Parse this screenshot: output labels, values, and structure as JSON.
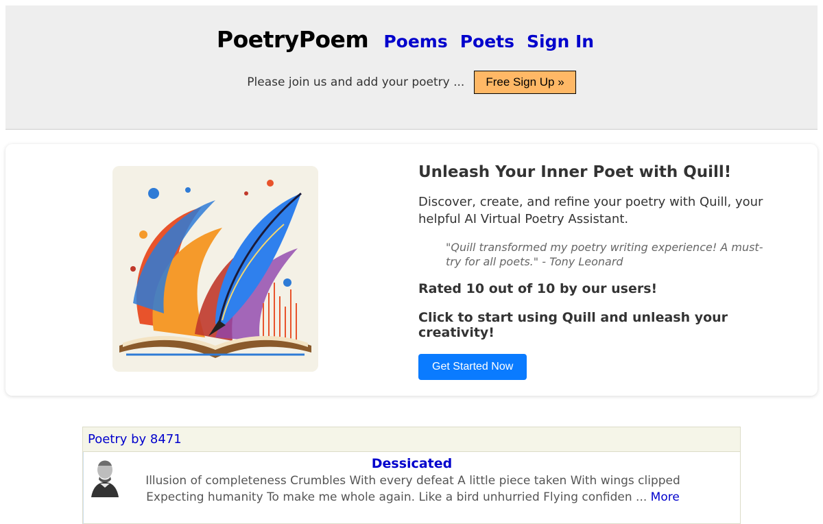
{
  "header": {
    "brand": "PoetryPoem",
    "nav": [
      "Poems",
      "Poets",
      "Sign In"
    ],
    "join_text": "Please join us and add your poetry ...",
    "signup_label": "Free Sign Up »"
  },
  "promo": {
    "title": "Unleash Your Inner Poet with Quill!",
    "description": "Discover, create, and refine your poetry with Quill, your helpful AI Virtual Poetry Assistant.",
    "quote": "\"Quill transformed my poetry writing experience! A must-try for all poets.\" - Tony Leonard",
    "rated": "Rated 10 out of 10 by our users!",
    "cta": "Click to start using Quill and unleash your creativity!",
    "button_label": "Get Started Now"
  },
  "poetry": {
    "heading": "Poetry by 8471",
    "items": [
      {
        "title": "Dessicated",
        "excerpt": "Illusion of completeness Crumbles With every defeat A little piece taken With wings clipped Expecting humanity To make me whole again. Like a bird unhurried Flying confiden ...",
        "more_label": "More"
      }
    ]
  },
  "colors": {
    "header_bg": "#eeeeee",
    "link": "#0000cc",
    "signup_bg": "#ffb866",
    "primary_button": "#0a7bff"
  },
  "icons": [
    "quill-book-illustration",
    "poet-portrait"
  ]
}
